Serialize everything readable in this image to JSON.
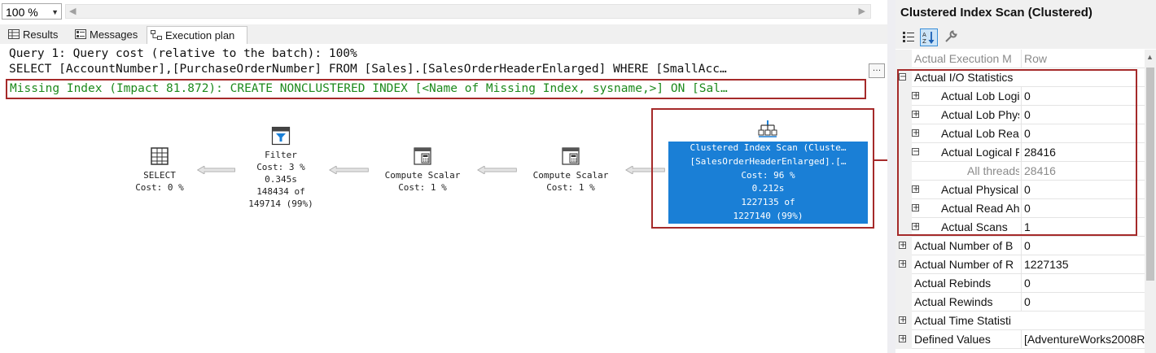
{
  "zoom": {
    "value": "100 %"
  },
  "tabs": [
    {
      "label": "Results",
      "icon": "grid-icon"
    },
    {
      "label": "Messages",
      "icon": "messages-icon"
    },
    {
      "label": "Execution plan",
      "icon": "execution-plan-icon"
    }
  ],
  "query": {
    "cost_line": "Query 1: Query cost (relative to the batch): 100%",
    "sql_line": "SELECT [AccountNumber],[PurchaseOrderNumber] FROM [Sales].[SalesOrderHeaderEnlarged] WHERE [SmallAcc…",
    "missing_index": "Missing Index (Impact 81.872): CREATE NONCLUSTERED INDEX [<Name of Missing Index, sysname,>] ON [Sal…",
    "ellipsis_label": "…"
  },
  "plan": {
    "select": {
      "name": "SELECT",
      "cost": "Cost: 0 %"
    },
    "filter": {
      "name": "Filter",
      "cost": "Cost: 3 %",
      "time": "0.345s",
      "rows": "148434 of",
      "estimate": "149714 (99%)"
    },
    "compute1": {
      "name": "Compute Scalar",
      "cost": "Cost: 1 %"
    },
    "compute2": {
      "name": "Compute Scalar",
      "cost": "Cost: 1 %"
    },
    "scan": {
      "name": "Clustered Index Scan (Cluste…",
      "object": "[SalesOrderHeaderEnlarged].[…",
      "cost": "Cost: 96 %",
      "time": "0.212s",
      "rows": "1227135 of",
      "estimate": "1227140 (99%)"
    }
  },
  "properties": {
    "title": "Clustered Index Scan (Clustered)",
    "rows": [
      {
        "name": "Actual Execution M",
        "value": "Row",
        "indent": 0,
        "expander": "none",
        "dim": true
      },
      {
        "name": "Actual I/O Statistics",
        "value": "",
        "indent": 0,
        "expander": "minus",
        "dim": false
      },
      {
        "name": "Actual Lob Logic",
        "value": "0",
        "indent": 1,
        "expander": "plus",
        "dim": false
      },
      {
        "name": "Actual Lob Physic",
        "value": "0",
        "indent": 1,
        "expander": "plus",
        "dim": false
      },
      {
        "name": "Actual Lob Read",
        "value": "0",
        "indent": 1,
        "expander": "plus",
        "dim": false
      },
      {
        "name": "Actual Logical Re",
        "value": "28416",
        "indent": 1,
        "expander": "minus",
        "dim": false
      },
      {
        "name": "All threads",
        "value": "28416",
        "indent": 2,
        "expander": "none",
        "dim": true
      },
      {
        "name": "Actual Physical R",
        "value": "0",
        "indent": 1,
        "expander": "plus",
        "dim": false
      },
      {
        "name": "Actual Read Ahe",
        "value": "0",
        "indent": 1,
        "expander": "plus",
        "dim": false
      },
      {
        "name": "Actual Scans",
        "value": "1",
        "indent": 1,
        "expander": "plus",
        "dim": false
      },
      {
        "name": "Actual Number of B",
        "value": "0",
        "indent": 0,
        "expander": "plus",
        "dim": false
      },
      {
        "name": "Actual Number of R",
        "value": "1227135",
        "indent": 0,
        "expander": "plus",
        "dim": false
      },
      {
        "name": "Actual Rebinds",
        "value": "0",
        "indent": 0,
        "expander": "none",
        "dim": false
      },
      {
        "name": "Actual Rewinds",
        "value": "0",
        "indent": 0,
        "expander": "none",
        "dim": false
      },
      {
        "name": "Actual Time Statisti",
        "value": "",
        "indent": 0,
        "expander": "plus",
        "dim": false
      },
      {
        "name": "Defined Values",
        "value": "[AdventureWorks2008R",
        "indent": 0,
        "expander": "plus",
        "dim": false
      }
    ]
  },
  "colors": {
    "accent": "#1a7fd6",
    "highlight": "#a52a2a",
    "missing_index": "#1d8a1d"
  }
}
